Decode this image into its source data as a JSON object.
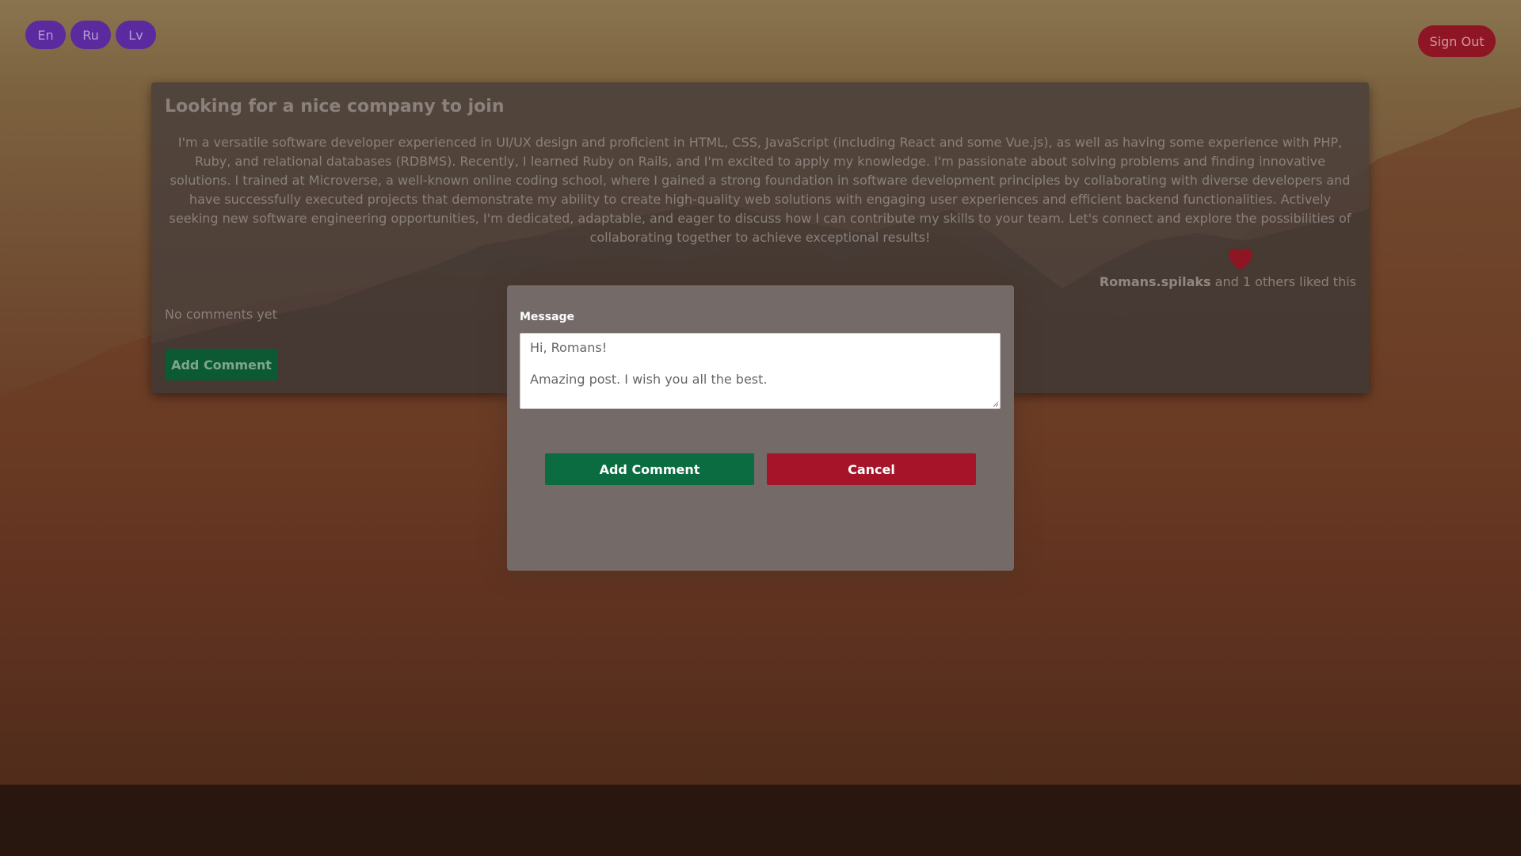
{
  "languages": [
    "En",
    "Ru",
    "Lv"
  ],
  "header": {
    "sign_out_label": "Sign Out"
  },
  "post": {
    "title": "Looking for a nice company to join",
    "body": "I'm a versatile software developer experienced in UI/UX design and proficient in HTML, CSS, JavaScript (including React and some Vue.js), as well as having some experience with PHP, Ruby, and relational databases (RDBMS). Recently, I learned Ruby on Rails, and I'm excited to apply my knowledge. I'm passionate about solving problems and finding innovative solutions. I trained at Microverse, a well-known online coding school, where I gained a strong foundation in software development principles by collaborating with diverse developers and have successfully executed projects that demonstrate my ability to create high-quality web solutions with engaging user experiences and efficient backend functionalities. Actively seeking new software engineering opportunities, I'm dedicated, adaptable, and eager to discuss how I can contribute my skills to your team. Let's connect and explore the possibilities of collaborating together to achieve exceptional results!",
    "likes": {
      "liker": "Romans.spilaks",
      "suffix": " and 1 others liked this"
    },
    "no_comments_text": "No comments yet",
    "add_comment_label": "Add Comment"
  },
  "modal": {
    "message_label": "Message",
    "message_value": "Hi, Romans!\n\nAmazing post. I wish you all the best.",
    "add_comment_label": "Add Comment",
    "cancel_label": "Cancel"
  },
  "colors": {
    "language_button": "#5b2a9e",
    "sign_out": "#8e1524",
    "add_comment": "#0a6c40",
    "cancel": "#a51428",
    "heart": "#8e1524"
  },
  "icons": {
    "like": "heart-icon",
    "resize": "resize-grip-icon"
  }
}
